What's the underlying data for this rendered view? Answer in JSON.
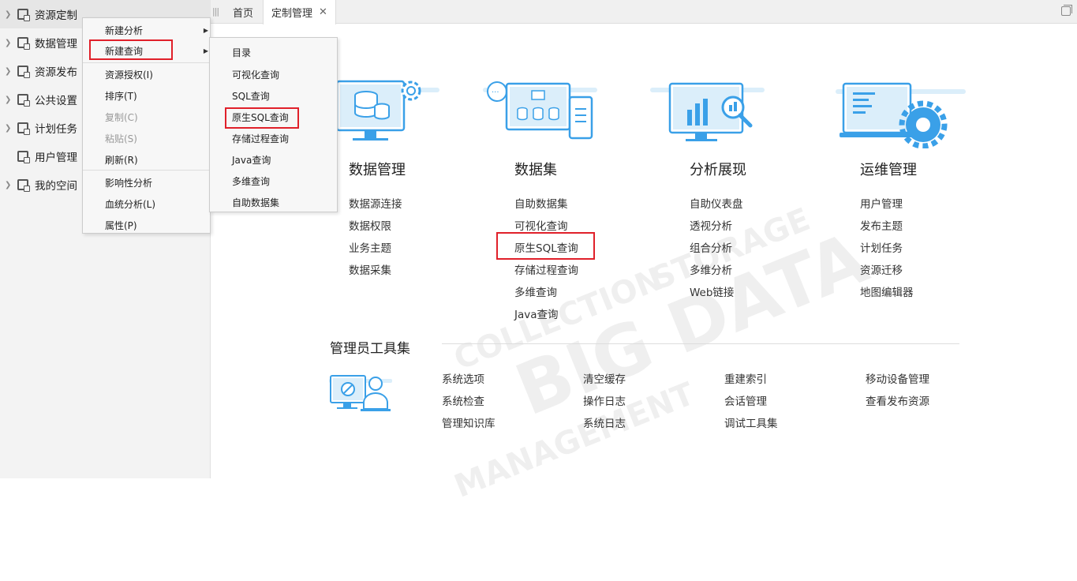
{
  "sidebar": {
    "items": [
      {
        "label": "资源定制"
      },
      {
        "label": "数据管理"
      },
      {
        "label": "资源发布"
      },
      {
        "label": "公共设置"
      },
      {
        "label": "计划任务"
      },
      {
        "label": "用户管理"
      },
      {
        "label": "我的空间"
      }
    ]
  },
  "tabs": [
    {
      "label": "首页"
    },
    {
      "label": "定制管理"
    }
  ],
  "context_menu": {
    "items": [
      {
        "label": "新建分析"
      },
      {
        "label": "新建查询"
      },
      {
        "label": "资源授权(I)"
      },
      {
        "label": "排序(T)"
      },
      {
        "label": "复制(C)"
      },
      {
        "label": "粘贴(S)"
      },
      {
        "label": "刷新(R)"
      },
      {
        "label": "影响性分析"
      },
      {
        "label": "血统分析(L)"
      },
      {
        "label": "属性(P)"
      }
    ]
  },
  "submenu": {
    "items": [
      {
        "label": "目录"
      },
      {
        "label": "可视化查询"
      },
      {
        "label": "SQL查询"
      },
      {
        "label": "原生SQL查询"
      },
      {
        "label": "存储过程查询"
      },
      {
        "label": "Java查询"
      },
      {
        "label": "多维查询"
      },
      {
        "label": "自助数据集"
      }
    ]
  },
  "categories": [
    {
      "title": "数据管理",
      "links": [
        "数据源连接",
        "数据权限",
        "业务主题",
        "数据采集"
      ]
    },
    {
      "title": "数据集",
      "links": [
        "自助数据集",
        "可视化查询",
        "原生SQL查询",
        "存储过程查询",
        "多维查询",
        "Java查询"
      ]
    },
    {
      "title": "分析展现",
      "links": [
        "自助仪表盘",
        "透视分析",
        "组合分析",
        "多维分析",
        "Web链接"
      ]
    },
    {
      "title": "运维管理",
      "links": [
        "用户管理",
        "发布主题",
        "计划任务",
        "资源迁移",
        "地图编辑器"
      ]
    }
  ],
  "admin_tools": {
    "title": "管理员工具集",
    "columns": [
      [
        "系统选项",
        "系统检查",
        "管理知识库"
      ],
      [
        "清空缓存",
        "操作日志",
        "系统日志"
      ],
      [
        "重建索引",
        "会话管理",
        "调试工具集"
      ],
      [
        "移动设备管理",
        "查看发布资源"
      ]
    ]
  },
  "colors": {
    "accent": "#3aa0e8",
    "illus_light": "#dbeefa",
    "highlight": "#e0202a"
  }
}
